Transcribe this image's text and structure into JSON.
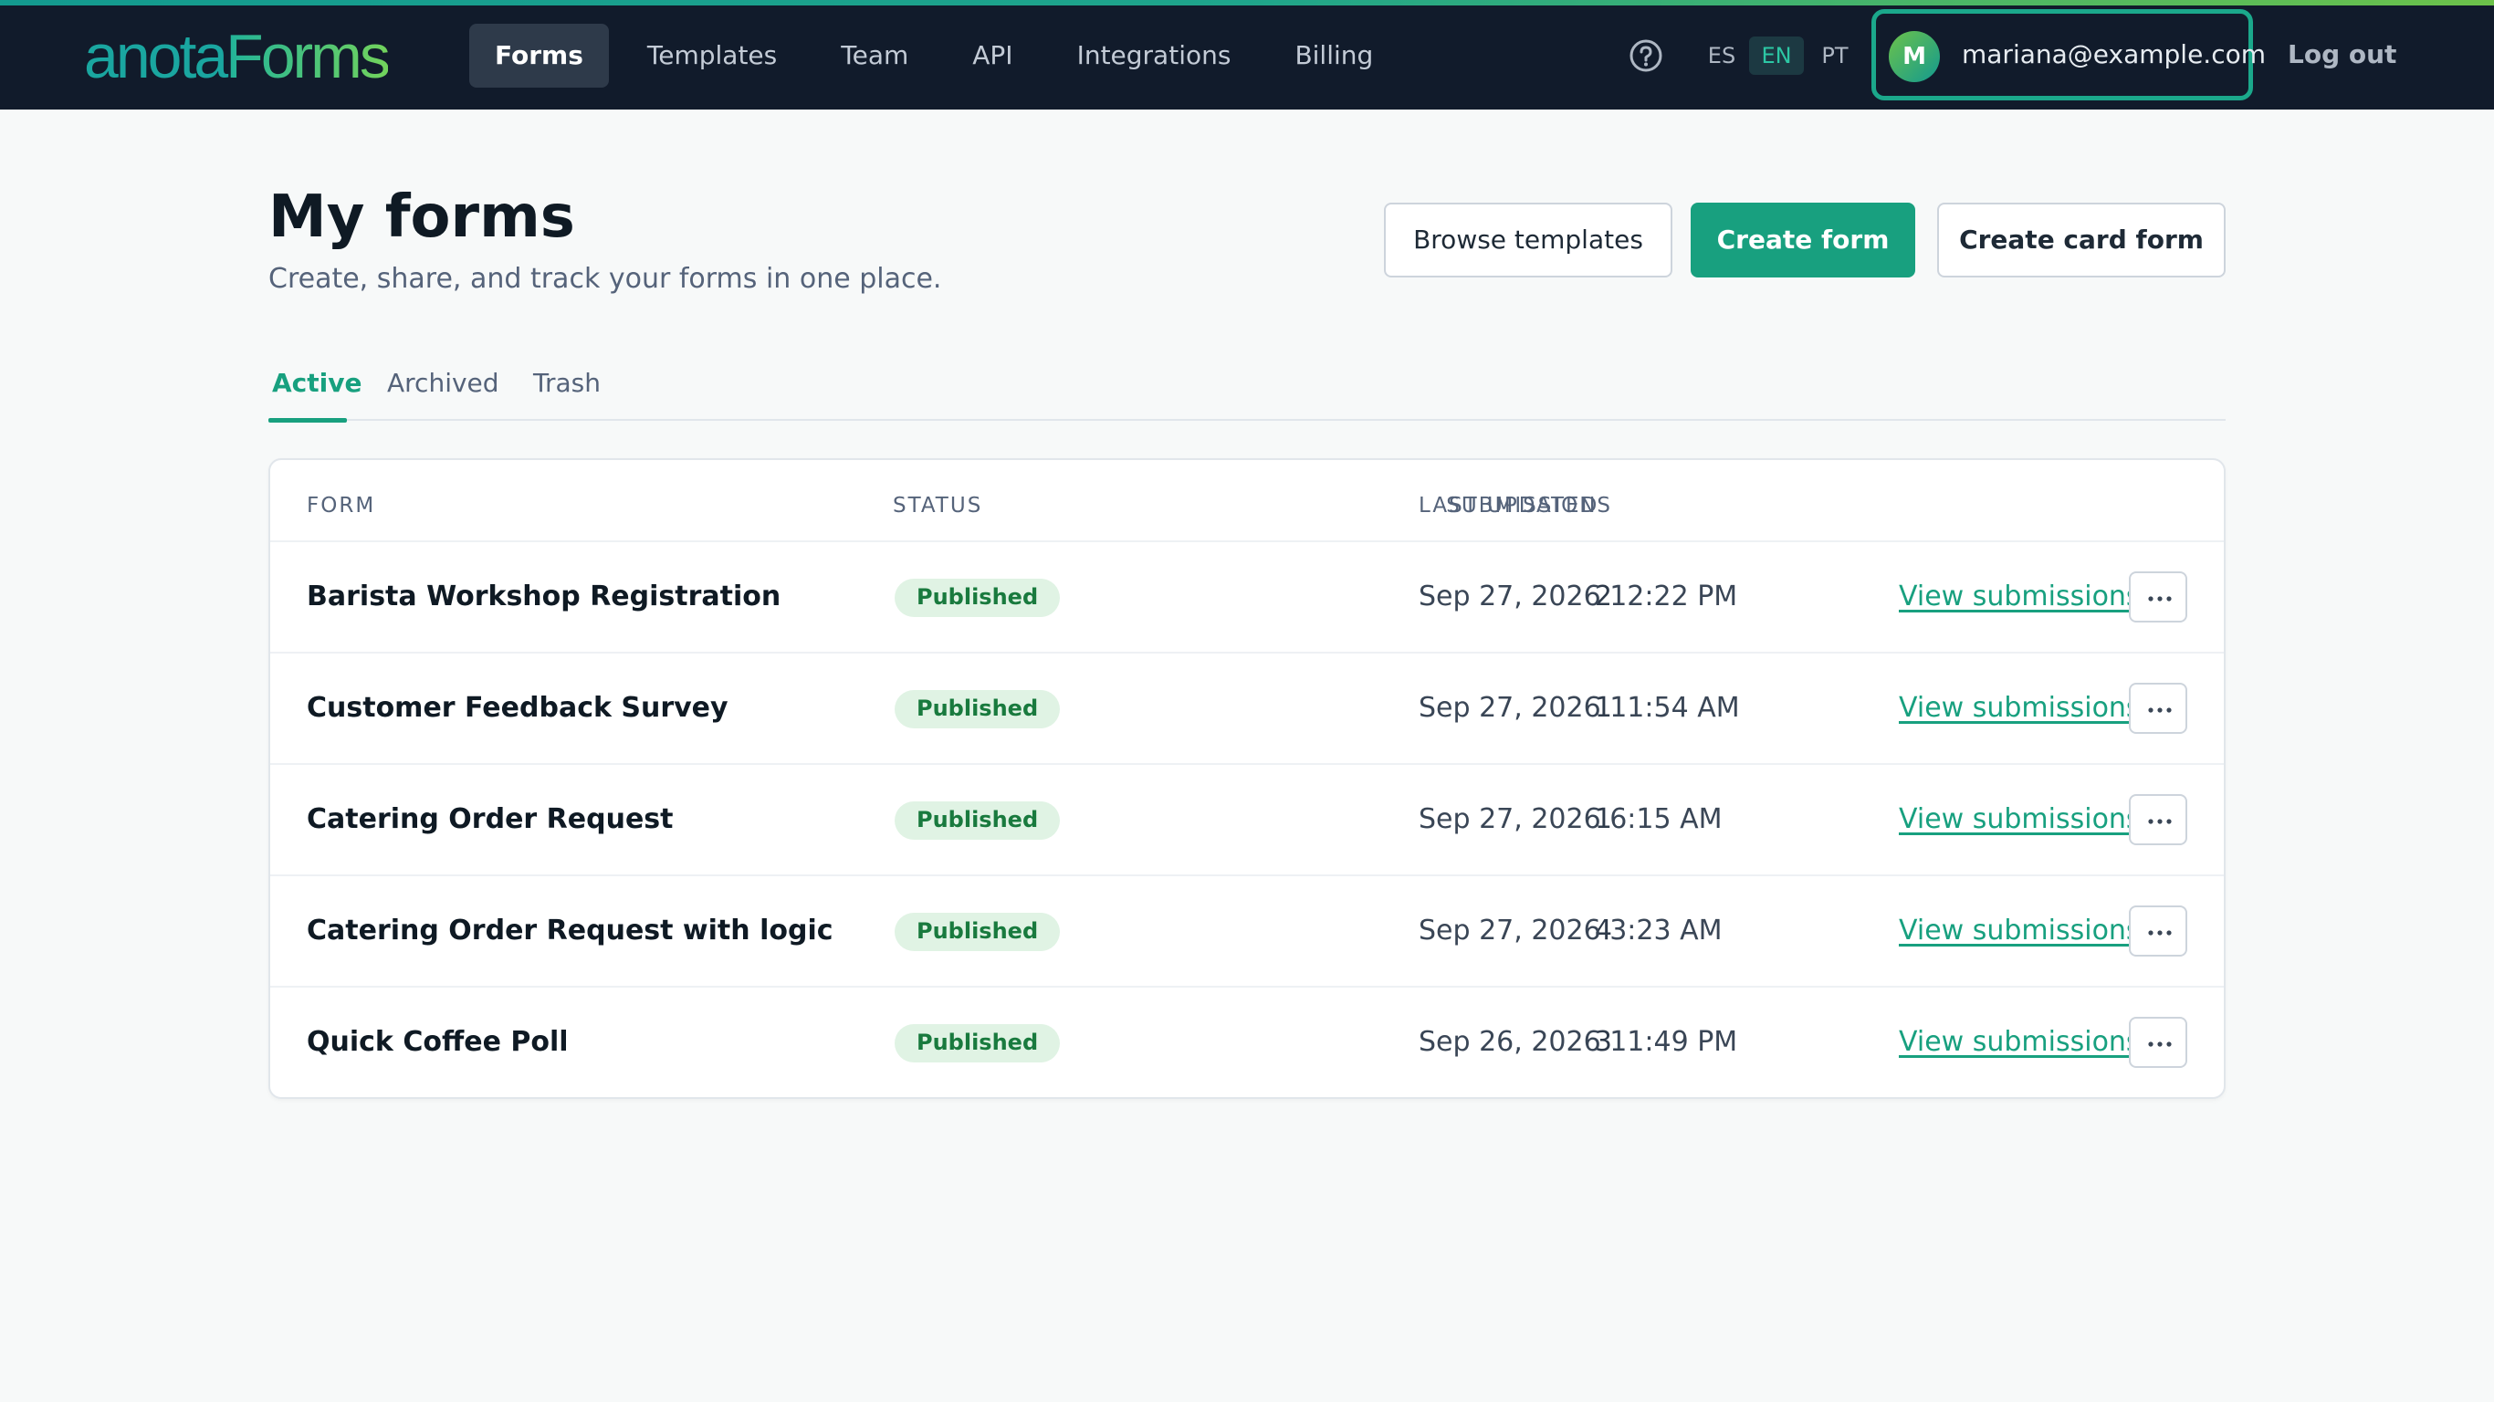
{
  "brand": {
    "part1": "anota",
    "part2": "Forms"
  },
  "nav": {
    "items": [
      {
        "label": "Forms",
        "active": true
      },
      {
        "label": "Templates",
        "active": false
      },
      {
        "label": "Team",
        "active": false
      },
      {
        "label": "API",
        "active": false
      },
      {
        "label": "Integrations",
        "active": false
      },
      {
        "label": "Billing",
        "active": false
      }
    ]
  },
  "header": {
    "help_icon": "question-circle-icon",
    "languages": [
      "ES",
      "EN",
      "PT"
    ],
    "active_language": "EN",
    "user": {
      "initial": "M",
      "email": "mariana@example.com"
    },
    "logout_label": "Log out"
  },
  "page": {
    "title": "My forms",
    "subtitle": "Create, share, and track your forms in one place.",
    "actions": {
      "browse_templates": "Browse templates",
      "create_form": "Create form",
      "create_card_form": "Create card form"
    }
  },
  "tabs": [
    {
      "label": "Active",
      "active": true
    },
    {
      "label": "Archived",
      "active": false
    },
    {
      "label": "Trash",
      "active": false
    }
  ],
  "table": {
    "columns": {
      "form": "FORM",
      "status": "STATUS",
      "submissions": "SUBMISSIONS",
      "last_updated": "LAST UPDATED"
    },
    "view_label": "View submissions",
    "more_icon": "ellipsis-icon",
    "rows": [
      {
        "name": "Barista Workshop Registration",
        "status": "Published",
        "submissions": "2",
        "updated": "Sep 27, 2026 12:22 PM"
      },
      {
        "name": "Customer Feedback Survey",
        "status": "Published",
        "submissions": "1",
        "updated": "Sep 27, 2026 11:54 AM"
      },
      {
        "name": "Catering Order Request",
        "status": "Published",
        "submissions": "1",
        "updated": "Sep 27, 2026 6:15 AM"
      },
      {
        "name": "Catering Order Request with logic",
        "status": "Published",
        "submissions": "4",
        "updated": "Sep 27, 2026 3:23 AM"
      },
      {
        "name": "Quick Coffee Poll",
        "status": "Published",
        "submissions": "3",
        "updated": "Sep 26, 2026 11:49 PM"
      }
    ]
  },
  "colors": {
    "topbar": "#111b2b",
    "accent": "#18a07f",
    "badge_bg": "#e0f3e4",
    "badge_text": "#197a3e"
  }
}
